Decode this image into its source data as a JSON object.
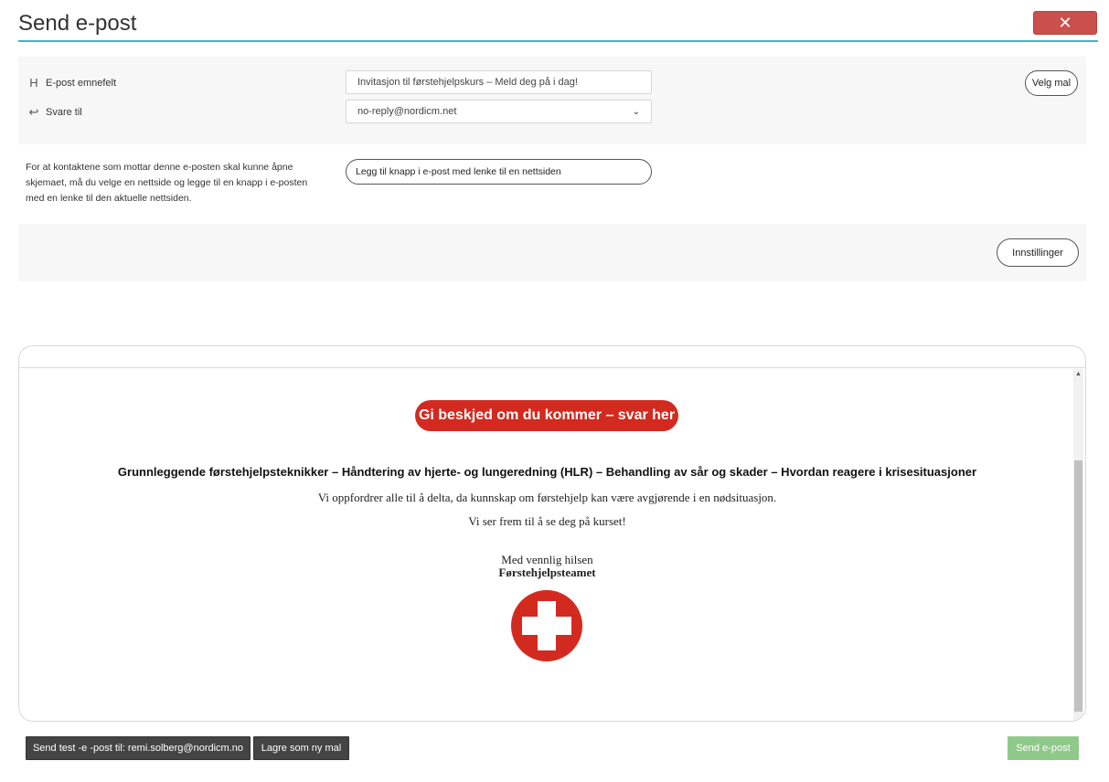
{
  "header": {
    "title": "Send e-post",
    "close_icon": "close-icon"
  },
  "form": {
    "subject_label": "E-post emnefelt",
    "subject_icon": "heading-icon",
    "subject_value": "Invitasjon til førstehjelpskurs – Meld deg på i dag!",
    "reply_label": "Svare til",
    "reply_icon": "reply-arrow-icon",
    "reply_value": "no-reply@nordicm.net",
    "template_button": "Velg mal",
    "help_text": "For at kontaktene som mottar denne e-posten skal kunne åpne skjemaet, må du velge en nettside og legge til en knapp i e-posten med en lenke til den aktuelle nettsiden.",
    "add_link_button": "Legg til knapp i e-post med lenke til en nettsiden",
    "settings_button": "Innstillinger"
  },
  "preview": {
    "cta": "Gi beskjed om du kommer – svar her",
    "headline": "Grunnleggende førstehjelpsteknikker – Håndtering av hjerte- og lungeredning (HLR) – Behandling av sår og skader – Hvordan reagere i krisesituasjoner",
    "line1": "Vi oppfordrer alle til å delta, da kunnskap om førstehjelp kan være avgjørende i en nødsituasjon.",
    "line2": "Vi ser frem til å se deg på kurset!",
    "closing": "Med vennlig hilsen",
    "signature": "Førstehjelpsteamet",
    "logo_icon": "first-aid-cross-icon",
    "colors": {
      "cta": "#d32a20",
      "logo": "#d32a20"
    }
  },
  "footer": {
    "test_button": "Send test -e -post til: remi.solberg@nordicm.no",
    "save_template_button": "Lagre som ny mal",
    "send_button": "Send e-post"
  },
  "colors": {
    "accent_line": "#3fb3c9",
    "close_button": "#c9504d",
    "send_button": "#8fc98a",
    "dark_button": "#444444"
  }
}
